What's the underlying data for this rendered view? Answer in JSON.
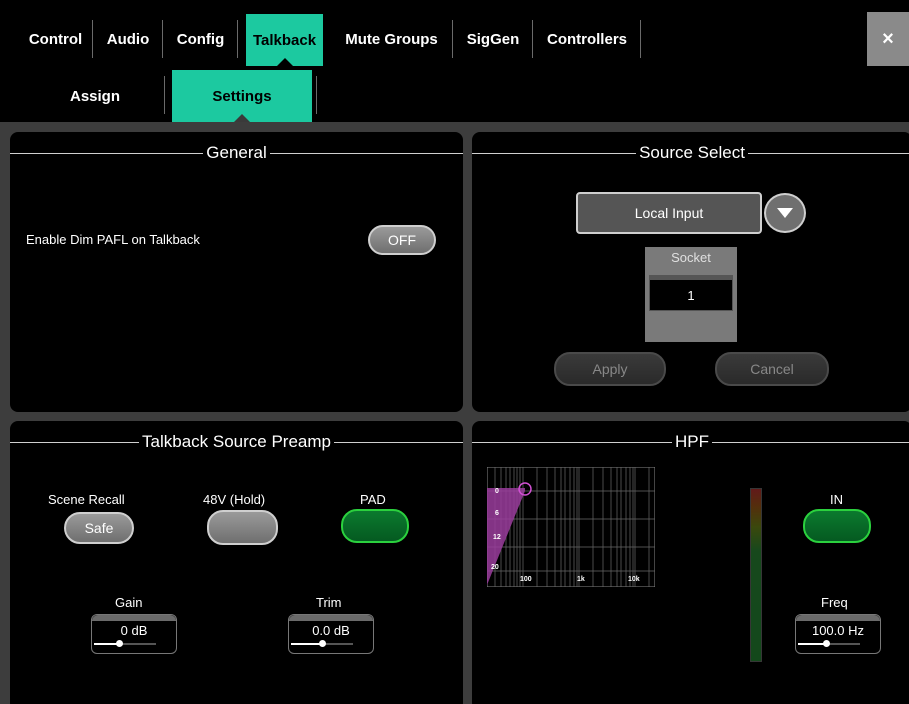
{
  "tabs": [
    {
      "label": "Control",
      "active": false
    },
    {
      "label": "Audio",
      "active": false
    },
    {
      "label": "Config",
      "active": false
    },
    {
      "label": "Talkback",
      "active": true
    },
    {
      "label": "Mute Groups",
      "active": false
    },
    {
      "label": "SigGen",
      "active": false
    },
    {
      "label": "Controllers",
      "active": false
    }
  ],
  "close_label": "×",
  "subtabs": [
    {
      "label": "Assign",
      "active": false
    },
    {
      "label": "Settings",
      "active": true
    }
  ],
  "general": {
    "title": "General",
    "dim_label": "Enable Dim PAFL on Talkback",
    "dim_value": "OFF"
  },
  "source_select": {
    "title": "Source Select",
    "source_value": "Local Input",
    "socket_label": "Socket",
    "socket_value": "1",
    "apply_label": "Apply",
    "cancel_label": "Cancel"
  },
  "preamp": {
    "title": "Talkback Source Preamp",
    "scene_recall_label": "Scene Recall",
    "scene_recall_value": "Safe",
    "phantom_label": "48V (Hold)",
    "pad_label": "PAD",
    "gain_label": "Gain",
    "gain_value": "0 dB",
    "gain_level": 0.4,
    "trim_label": "Trim",
    "trim_value": "0.0 dB",
    "trim_level": 0.5
  },
  "hpf": {
    "title": "HPF",
    "in_label": "IN",
    "freq_label": "Freq",
    "freq_value": "100.0 Hz",
    "freq_level": 0.45,
    "graph_x_labels": [
      "100",
      "1k",
      "10k"
    ],
    "graph_y_labels": [
      "0",
      "6",
      "12",
      "20"
    ]
  },
  "colors": {
    "accent": "#1cc9a0",
    "on_green": "#2bd13e",
    "filter_curve": "#c24bc4"
  }
}
